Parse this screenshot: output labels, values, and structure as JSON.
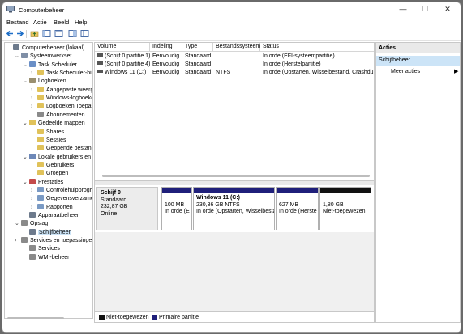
{
  "window": {
    "title": "Computerbeheer"
  },
  "menu": [
    "Bestand",
    "Actie",
    "Beeld",
    "Help"
  ],
  "tree": [
    {
      "label": "Computerbeheer (lokaal)",
      "indent": 0,
      "chev": "",
      "color": "#6d7a8c"
    },
    {
      "label": "Systeemwerkset",
      "indent": 1,
      "chev": "v",
      "color": "#7f8fa6"
    },
    {
      "label": "Task Scheduler",
      "indent": 2,
      "chev": "v",
      "color": "#6a8fc7"
    },
    {
      "label": "Task Scheduler-bibliot",
      "indent": 3,
      "chev": ">",
      "color": "#e0c25a"
    },
    {
      "label": "Logboeken",
      "indent": 2,
      "chev": "v",
      "color": "#9a8f70"
    },
    {
      "label": "Aangepaste weergav",
      "indent": 3,
      "chev": ">",
      "color": "#e0c25a"
    },
    {
      "label": "Windows-logboeken",
      "indent": 3,
      "chev": ">",
      "color": "#e0c25a"
    },
    {
      "label": "Logboeken Toepass",
      "indent": 3,
      "chev": ">",
      "color": "#e0c25a"
    },
    {
      "label": "Abonnementen",
      "indent": 3,
      "chev": "",
      "color": "#8a8a8a"
    },
    {
      "label": "Gedeelde mappen",
      "indent": 2,
      "chev": "v",
      "color": "#e0c25a"
    },
    {
      "label": "Shares",
      "indent": 3,
      "chev": "",
      "color": "#e0c25a"
    },
    {
      "label": "Sessies",
      "indent": 3,
      "chev": "",
      "color": "#e0c25a"
    },
    {
      "label": "Geopende bestande",
      "indent": 3,
      "chev": "",
      "color": "#e0c25a"
    },
    {
      "label": "Lokale gebruikers en gro",
      "indent": 2,
      "chev": "v",
      "color": "#6d88b8"
    },
    {
      "label": "Gebruikers",
      "indent": 3,
      "chev": "",
      "color": "#e0c25a"
    },
    {
      "label": "Groepen",
      "indent": 3,
      "chev": "",
      "color": "#e0c25a"
    },
    {
      "label": "Prestaties",
      "indent": 2,
      "chev": "v",
      "color": "#c44b4b"
    },
    {
      "label": "Controlehulpprogra",
      "indent": 3,
      "chev": ">",
      "color": "#7a9ac4"
    },
    {
      "label": "Gegevensverzamela",
      "indent": 3,
      "chev": ">",
      "color": "#7a9ac4"
    },
    {
      "label": "Rapporten",
      "indent": 3,
      "chev": ">",
      "color": "#7a9ac4"
    },
    {
      "label": "Apparaatbeheer",
      "indent": 2,
      "chev": "",
      "color": "#6d7a8c"
    },
    {
      "label": "Opslag",
      "indent": 1,
      "chev": "v",
      "color": "#8a8a8a"
    },
    {
      "label": "Schijfbeheer",
      "indent": 2,
      "chev": "",
      "color": "#6d7a8c",
      "selected": true
    },
    {
      "label": "Services en toepassingen",
      "indent": 1,
      "chev": ">",
      "color": "#8a8a8a"
    },
    {
      "label": "Services",
      "indent": 2,
      "chev": "",
      "color": "#8a8a8a"
    },
    {
      "label": "WMI-beheer",
      "indent": 2,
      "chev": "",
      "color": "#8a8a8a"
    }
  ],
  "volumes": {
    "headers": [
      "Volume",
      "Indeling",
      "Type",
      "Bestandssysteem",
      "Status"
    ],
    "rows": [
      [
        "(Schijf 0 partitie 1)",
        "Eenvoudig",
        "Standaard",
        "",
        "In orde (EFI-systeempartitie)"
      ],
      [
        "(Schijf 0 partitie 4)",
        "Eenvoudig",
        "Standaard",
        "",
        "In orde (Herstelpartitie)"
      ],
      [
        "Windows 11 (C:)",
        "Eenvoudig",
        "Standaard",
        "NTFS",
        "In orde (Opstarten, Wisselbestand, Crashdun"
      ]
    ]
  },
  "disk": {
    "name": "Schijf 0",
    "type": "Standaard",
    "size": "232,87 GB",
    "status": "Online",
    "partitions": [
      {
        "title": "",
        "size": "100 MB",
        "status": "In orde (E",
        "bar_color": "#1f1f7a"
      },
      {
        "title": "Windows 11  (C:)",
        "size": "230,36 GB NTFS",
        "status": "In orde (Opstarten, Wisselbesta",
        "bar_color": "#1f1f7a"
      },
      {
        "title": "",
        "size": "627 MB",
        "status": "In orde (Herste",
        "bar_color": "#1f1f7a"
      },
      {
        "title": "",
        "size": "1,80 GB",
        "status": "Niet-toegewezen",
        "bar_color": "#111111"
      }
    ]
  },
  "legend": [
    {
      "label": "Niet-toegewezen",
      "color": "#111111"
    },
    {
      "label": "Primaire partitie",
      "color": "#1f1f7a"
    }
  ],
  "actions": {
    "header": "Acties",
    "section": "Schijfbeheer",
    "item": "Meer acties",
    "arrow": "▶"
  },
  "window_controls": {
    "minimize": "—",
    "maximize": "☐",
    "close": "✕"
  }
}
